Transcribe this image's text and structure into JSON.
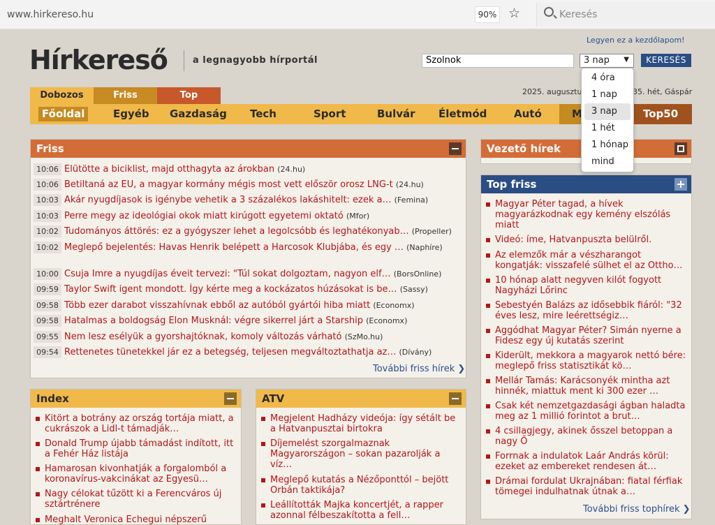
{
  "browser": {
    "url": "www.hirkereso.hu",
    "zoom": "90%",
    "search_placeholder": "Keresés"
  },
  "header": {
    "home_link": "Legyen ez a kezdőlapom!",
    "logo": "Hírkereső",
    "tagline": "a legnagyobb hírportál",
    "search_value": "Szolnok",
    "period_selected": "3 nap",
    "search_button": "KERESÉS",
    "period_options": [
      "4 óra",
      "1 nap",
      "3 nap",
      "1 hét",
      "1 hónap",
      "mind"
    ]
  },
  "tabs": [
    "Dobozos",
    "Friss",
    "Top"
  ],
  "date_text": "2025. augusztu",
  "date_text2": "35. hét, Gáspár",
  "nav": {
    "items": [
      "Főoldal",
      "Egyéb",
      "Gazdaság",
      "Tech",
      "Sport",
      "Bulvár",
      "Életmód",
      "Autó"
    ],
    "more": "M",
    "top50": "Top50"
  },
  "friss": {
    "title": "Friss",
    "items": [
      {
        "time": "10:06",
        "title": "Elütötte a biciklist, majd otthagyta az árokban",
        "source": "(24.hu)"
      },
      {
        "time": "10:06",
        "title": "Betiltaná az EU, a magyar kormány mégis most vett először orosz LNG-t",
        "source": "(24.hu)"
      },
      {
        "time": "10:03",
        "title": "Akár nyugdíjasok is igénybe vehetik a 3 százalékos lakáshitelt: ezek a…",
        "source": "(Femina)"
      },
      {
        "time": "10:03",
        "title": "Perre megy az ideológiai okok miatt kirúgott egyetemi oktató",
        "source": "(Mfor)"
      },
      {
        "time": "10:02",
        "title": "Tudományos áttörés: ez a gyógyszer lehet a legolcsóbb és leghatékonyab…",
        "source": "(Propeller)"
      },
      {
        "time": "10:02",
        "title": "Meglepő bejelentés: Havas Henrik belépett a Harcosok Klubjába, és egy …",
        "source": "(Naphíre)"
      },
      {
        "time": "10:00",
        "title": "Csuja Imre a nyugdíjas éveit tervezi: \"Túl sokat dolgoztam, nagyon elf…",
        "source": "(BorsOnline)"
      },
      {
        "time": "09:59",
        "title": "Taylor Swift igent mondott. Így kérte meg a kockázatos húzásokat is be…",
        "source": "(Sassy)"
      },
      {
        "time": "09:58",
        "title": "Több ezer darabot visszahívnak ebből az autóból gyártói hiba miatt",
        "source": "(Economx)"
      },
      {
        "time": "09:58",
        "title": "Hatalmas a boldogság Elon Musknál: végre sikerrel járt a Starship",
        "source": "(Economx)"
      },
      {
        "time": "09:55",
        "title": "Nem lesz esélyük a gyorshajtóknak, komoly változás várható",
        "source": "(SzMo.hu)"
      },
      {
        "time": "09:54",
        "title": "Rettenetes tünetekkel jár ez a betegség, teljesen megváltoztathatja az…",
        "source": "(Dívány)"
      }
    ],
    "more": "További friss hírek ❯"
  },
  "vezeto": {
    "title": "Vezető hírek"
  },
  "topfriss": {
    "title": "Top friss",
    "items": [
      "Magyar Péter tagad, a hívek magyarázkodnak egy kemény elszólás miatt",
      "Videó: íme, Hatvanpuszta belülről.",
      "Az elemzők már a vészharangot kongatják: visszafelé sülhet el az Ottho…",
      "10 hónap alatt negyven kilót fogyott Nagyházi Lőrinc",
      "Sebestyén Balázs az idősebbik fiáról: \"32 éves lesz, mire leérettségiz…",
      "Aggódhat Magyar Péter? Simán nyerne a Fidesz egy új kutatás szerint",
      "Kiderült, mekkora a magyarok nettó bére: meglepő friss statisztikát kö…",
      "Mellár Tamás: Karácsonyék mintha azt hinnék, miattuk ment ki 300 ezer …",
      "Csak két nemzetgazdasági ágban haladta meg az 1 millió forintot a brut…",
      "4 csillagjegy, akinek ősszel betoppan a nagy Ő",
      "Forrnak a indulatok Laár András körül: ezeket az embereket rendesen át…",
      "Drámai fordulat Ukrajnában: fiatal férfiak tömegei indulhatnak útnak a…"
    ],
    "more": "További friss tophírek ❯"
  },
  "index": {
    "title": "Index",
    "items": [
      "Kitört a botrány az ország tortája miatt, a cukrászok a Lidl-t támadják…",
      "Donald Trump újabb támadást indított, itt a Fehér Ház listája",
      "Hamarosan kivonhatják a forgalomból a koronavírus-vakcinákat az Egyesü…",
      "Nagy célokat tűzött ki a Ferencváros új sztártrénere",
      "Meghalt Veronica Echegui népszerű"
    ]
  },
  "atv": {
    "title": "ATV",
    "items": [
      "Megjelent Hadházy videója: így sétált be a Hatvanpusztai birtokra",
      "Díjemelést szorgalmaznak Magyarországon – sokan pazarolják a víz…",
      "Meglepő kutatás a Nézőponttól – bejött Orbán taktikája?",
      "Leállították Majka koncertjét, a rapper azonnal félbeszakította a fell…"
    ]
  }
}
